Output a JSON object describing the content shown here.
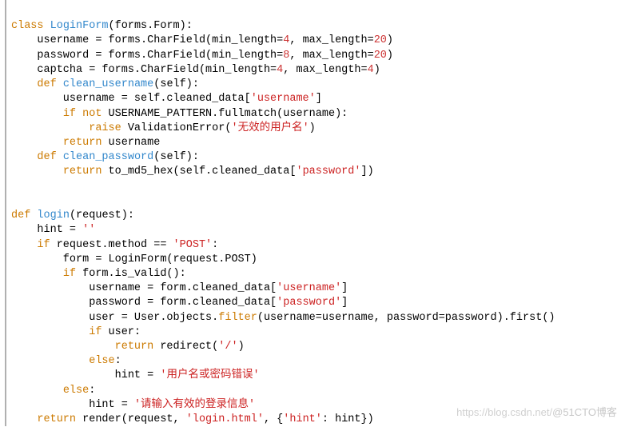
{
  "code": {
    "l1": {
      "kw1": "class",
      "cls": "LoginForm",
      "txt": "(forms.Form):"
    },
    "l2": {
      "pre": "    username = forms.CharField(min_length=",
      "n1": "4",
      "mid": ", max_length=",
      "n2": "20",
      "end": ")"
    },
    "l3": {
      "pre": "    password = forms.CharField(min_length=",
      "n1": "8",
      "mid": ", max_length=",
      "n2": "20",
      "end": ")"
    },
    "l4": {
      "pre": "    captcha = forms.CharField(min_length=",
      "n1": "4",
      "mid": ", max_length=",
      "n2": "4",
      "end": ")"
    },
    "l5": {
      "kw": "def",
      "fn": "clean_username",
      "sig": "(self):"
    },
    "l6": {
      "pre": "        username = self.cleaned_data[",
      "str": "'username'",
      "end": "]"
    },
    "l7": {
      "kw1": "if not",
      "mid": " USERNAME_PATTERN.fullmatch(username):"
    },
    "l8": {
      "kw": "raise",
      "mid": " ValidationError(",
      "str": "'无效的用户名'",
      "end": ")"
    },
    "l9": {
      "kw": "return",
      "txt": " username"
    },
    "l10": {
      "kw": "def",
      "fn": "clean_password",
      "sig": "(self):"
    },
    "l11": {
      "kw": "return",
      "mid": " to_md5_hex(self.cleaned_data[",
      "str": "'password'",
      "end": "])"
    },
    "l12": "",
    "l13": "",
    "l14": {
      "kw": "def",
      "fn": "login",
      "sig": "(request):"
    },
    "l15": {
      "pre": "    hint = ",
      "str": "''"
    },
    "l16": {
      "kw": "if",
      "mid": " request.method == ",
      "str": "'POST'",
      "end": ":"
    },
    "l17": {
      "pre": "        form = LoginForm(request.POST)"
    },
    "l18": {
      "kw": "if",
      "mid": " form.is_valid():"
    },
    "l19": {
      "pre": "            username = form.cleaned_data[",
      "str": "'username'",
      "end": "]"
    },
    "l20": {
      "pre": "            password = form.cleaned_data[",
      "str": "'password'",
      "end": "]"
    },
    "l21": {
      "pre": "            user = User.objects.",
      "flt": "filter",
      "mid": "(username=username, password=password).first()"
    },
    "l22": {
      "kw": "if",
      "txt": " user:"
    },
    "l23": {
      "kw": "return",
      "mid": " redirect(",
      "str": "'/'",
      "end": ")"
    },
    "l24": {
      "kw": "else",
      "end": ":"
    },
    "l25": {
      "pre": "                hint = ",
      "str": "'用户名或密码错误'"
    },
    "l26": {
      "kw": "else",
      "end": ":"
    },
    "l27": {
      "pre": "            hint = ",
      "str": "'请输入有效的登录信息'"
    },
    "l28": {
      "kw": "return",
      "mid": " render(request, ",
      "str1": "'login.html'",
      "mid2": ", {",
      "str2": "'hint'",
      "end": ": hint})"
    }
  },
  "watermark": {
    "a": "https://blog.csdn.net/",
    "b": "@51CTO博客"
  }
}
